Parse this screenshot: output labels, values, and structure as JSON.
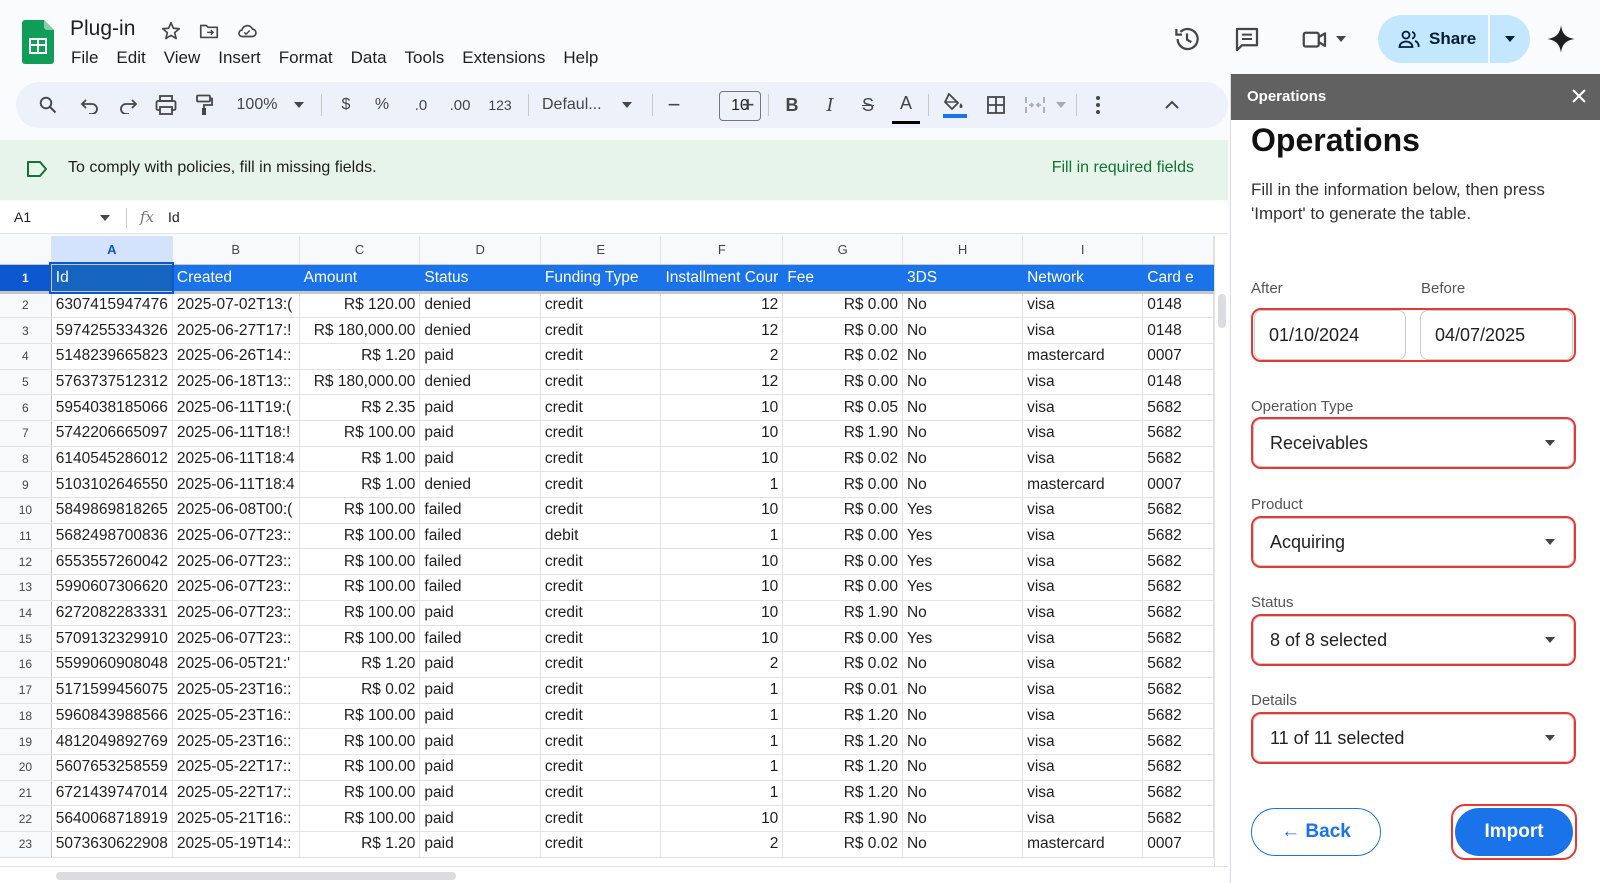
{
  "app": {
    "doc_title": "Plug-in",
    "menu": [
      "File",
      "Edit",
      "View",
      "Insert",
      "Format",
      "Data",
      "Tools",
      "Extensions",
      "Help"
    ],
    "share_label": "Share"
  },
  "toolbar": {
    "zoom": "100%",
    "currency": "$",
    "percent": "%",
    "dec_decrease": ".0",
    "dec_increase": ".00",
    "number_format": "123",
    "font": "Defaul...",
    "font_size": "10",
    "minus": "−",
    "plus": "+",
    "bold": "B",
    "italic": "I",
    "strike": "S",
    "text_color": "A"
  },
  "banner": {
    "text": "To comply with policies, fill in missing fields.",
    "link": "Fill in required fields"
  },
  "formula_bar": {
    "cell_ref": "A1",
    "fx": "fx",
    "value": "Id"
  },
  "sheet": {
    "columns": [
      "A",
      "B",
      "C",
      "D",
      "E",
      "F",
      "G",
      "H",
      "I",
      ""
    ],
    "header": [
      "Id",
      "Created",
      "Amount",
      "Status",
      "Funding Type",
      "Installment Cour",
      "Fee",
      "3DS",
      "Network",
      "Card e"
    ],
    "rows": [
      [
        "2",
        "6307415947476",
        "2025-07-02T13:(",
        "R$ 120.00",
        "denied",
        "credit",
        "12",
        "R$ 0.00",
        "No",
        "visa",
        "0148"
      ],
      [
        "3",
        "5974255334326",
        "2025-06-27T17:!",
        "R$ 180,000.00",
        "denied",
        "credit",
        "12",
        "R$ 0.00",
        "No",
        "visa",
        "0148"
      ],
      [
        "4",
        "5148239665823",
        "2025-06-26T14::",
        "R$ 1.20",
        "paid",
        "credit",
        "2",
        "R$ 0.02",
        "No",
        "mastercard",
        "0007"
      ],
      [
        "5",
        "5763737512312",
        "2025-06-18T13::",
        "R$ 180,000.00",
        "denied",
        "credit",
        "12",
        "R$ 0.00",
        "No",
        "visa",
        "0148"
      ],
      [
        "6",
        "5954038185066",
        "2025-06-11T19:(",
        "R$ 2.35",
        "paid",
        "credit",
        "10",
        "R$ 0.05",
        "No",
        "visa",
        "5682"
      ],
      [
        "7",
        "5742206665097",
        "2025-06-11T18:!",
        "R$ 100.00",
        "paid",
        "credit",
        "10",
        "R$ 1.90",
        "No",
        "visa",
        "5682"
      ],
      [
        "8",
        "6140545286012",
        "2025-06-11T18:4",
        "R$ 1.00",
        "paid",
        "credit",
        "10",
        "R$ 0.02",
        "No",
        "visa",
        "5682"
      ],
      [
        "9",
        "5103102646550",
        "2025-06-11T18:4",
        "R$ 1.00",
        "denied",
        "credit",
        "1",
        "R$ 0.00",
        "No",
        "mastercard",
        "0007"
      ],
      [
        "10",
        "5849869818265",
        "2025-06-08T00:(",
        "R$ 100.00",
        "failed",
        "credit",
        "10",
        "R$ 0.00",
        "Yes",
        "visa",
        "5682"
      ],
      [
        "11",
        "5682498700836",
        "2025-06-07T23::",
        "R$ 100.00",
        "failed",
        "debit",
        "1",
        "R$ 0.00",
        "Yes",
        "visa",
        "5682"
      ],
      [
        "12",
        "6553557260042",
        "2025-06-07T23::",
        "R$ 100.00",
        "failed",
        "credit",
        "10",
        "R$ 0.00",
        "Yes",
        "visa",
        "5682"
      ],
      [
        "13",
        "5990607306620",
        "2025-06-07T23::",
        "R$ 100.00",
        "failed",
        "credit",
        "10",
        "R$ 0.00",
        "Yes",
        "visa",
        "5682"
      ],
      [
        "14",
        "6272082283331",
        "2025-06-07T23::",
        "R$ 100.00",
        "paid",
        "credit",
        "10",
        "R$ 1.90",
        "No",
        "visa",
        "5682"
      ],
      [
        "15",
        "5709132329910",
        "2025-06-07T23::",
        "R$ 100.00",
        "failed",
        "credit",
        "10",
        "R$ 0.00",
        "Yes",
        "visa",
        "5682"
      ],
      [
        "16",
        "5599060908048",
        "2025-06-05T21:'",
        "R$ 1.20",
        "paid",
        "credit",
        "2",
        "R$ 0.02",
        "No",
        "visa",
        "5682"
      ],
      [
        "17",
        "5171599456075",
        "2025-05-23T16::",
        "R$ 0.02",
        "paid",
        "credit",
        "1",
        "R$ 0.01",
        "No",
        "visa",
        "5682"
      ],
      [
        "18",
        "5960843988566",
        "2025-05-23T16::",
        "R$ 100.00",
        "paid",
        "credit",
        "1",
        "R$ 1.20",
        "No",
        "visa",
        "5682"
      ],
      [
        "19",
        "4812049892769",
        "2025-05-23T16::",
        "R$ 100.00",
        "paid",
        "credit",
        "1",
        "R$ 1.20",
        "No",
        "visa",
        "5682"
      ],
      [
        "20",
        "5607653258559",
        "2025-05-22T17::",
        "R$ 100.00",
        "paid",
        "credit",
        "1",
        "R$ 1.20",
        "No",
        "visa",
        "5682"
      ],
      [
        "21",
        "6721439747014",
        "2025-05-22T17::",
        "R$ 100.00",
        "paid",
        "credit",
        "1",
        "R$ 1.20",
        "No",
        "visa",
        "5682"
      ],
      [
        "22",
        "5640068718919",
        "2025-05-21T16::",
        "R$ 100.00",
        "paid",
        "credit",
        "10",
        "R$ 1.90",
        "No",
        "visa",
        "5682"
      ],
      [
        "23",
        "5073630622908",
        "2025-05-19T14::",
        "R$ 1.20",
        "paid",
        "credit",
        "2",
        "R$ 0.02",
        "No",
        "mastercard",
        "0007"
      ]
    ]
  },
  "panel": {
    "header_title": "Operations",
    "heading": "Operations",
    "description": "Fill in the information below, then press 'Import' to generate the table.",
    "after_label": "After",
    "after_value": "01/10/2024",
    "before_label": "Before",
    "before_value": "04/07/2025",
    "operation_type_label": "Operation Type",
    "operation_type_value": "Receivables",
    "product_label": "Product",
    "product_value": "Acquiring",
    "status_label": "Status",
    "status_value": "8 of 8 selected",
    "details_label": "Details",
    "details_value": "11 of 11 selected",
    "back_label": "← Back",
    "import_label": "Import"
  },
  "colors": {
    "header_blue": "#1a73e8",
    "banner_green": "#e6f4ea",
    "share_blue": "#c2e7ff",
    "highlight_red": "#e53935"
  }
}
